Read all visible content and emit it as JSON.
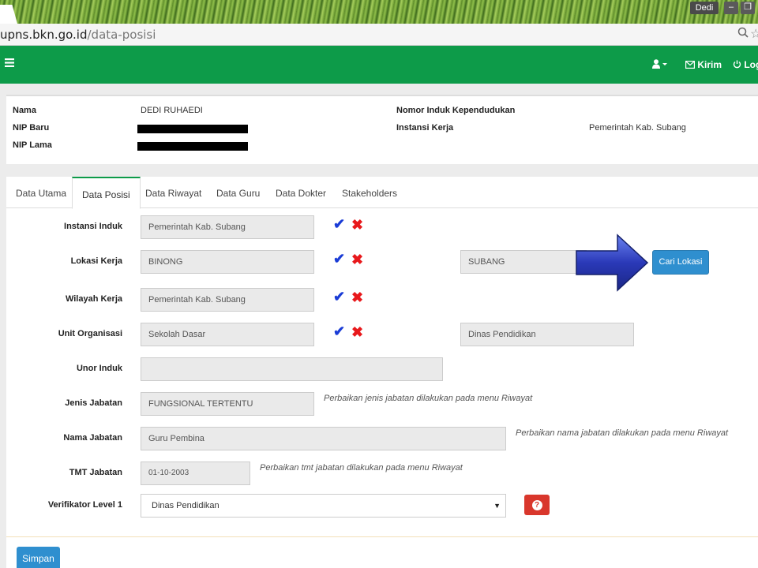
{
  "browser": {
    "user_badge": "Dedi",
    "minimize": "–",
    "restore": "❐",
    "url_host": "upns.bkn.go.id",
    "url_path": "/data-posisi"
  },
  "navbar": {
    "menu_icon": "≡",
    "user_icon": "👤▾",
    "kirim_label": "Kirim",
    "logout_label": "Logout",
    "color": "#0d9b49"
  },
  "profile": {
    "nama_label": "Nama",
    "nama_value": "DEDI RUHAEDI",
    "nip_baru_label": "NIP Baru",
    "nip_lama_label": "NIP Lama",
    "nik_label": "Nomor Induk Kependudukan",
    "instansi_kerja_label": "Instansi Kerja",
    "instansi_kerja_value": "Pemerintah Kab. Subang"
  },
  "tabs": [
    "Data Utama",
    "Data Posisi",
    "Data Riwayat",
    "Data Guru",
    "Data Dokter",
    "Stakeholders"
  ],
  "form": {
    "instansi_induk": {
      "label": "Instansi Induk",
      "value": "Pemerintah Kab. Subang"
    },
    "lokasi_kerja": {
      "label": "Lokasi Kerja",
      "value": "BINONG",
      "extra": "SUBANG"
    },
    "wilayah_kerja": {
      "label": "Wilayah Kerja",
      "value": "Pemerintah Kab. Subang"
    },
    "unit_organisasi": {
      "label": "Unit Organisasi",
      "value": "Sekolah Dasar",
      "extra": "Dinas Pendidikan"
    },
    "unor_induk": {
      "label": "Unor Induk",
      "value": ""
    },
    "jenis_jabatan": {
      "label": "Jenis Jabatan",
      "value": "FUNGSIONAL TERTENTU",
      "note": "Perbaikan jenis jabatan dilakukan pada menu Riwayat"
    },
    "nama_jabatan": {
      "label": "Nama Jabatan",
      "value": "Guru Pembina",
      "note": "Perbaikan nama jabatan dilakukan pada menu Riwayat"
    },
    "tmt_jabatan": {
      "label": "TMT Jabatan",
      "value": "01-10-2003",
      "note": "Perbaikan tmt jabatan dilakukan pada menu Riwayat"
    },
    "verifikator": {
      "label": "Verifikator Level 1",
      "value": "Dinas Pendidikan"
    }
  },
  "icons": {
    "check": "✔",
    "cross": "✖",
    "help": "?",
    "caret": "▼",
    "search": "🔍",
    "star": "☆"
  },
  "buttons": {
    "cari_lokasi": "Cari Lokasi",
    "simpan": "Simpan"
  }
}
